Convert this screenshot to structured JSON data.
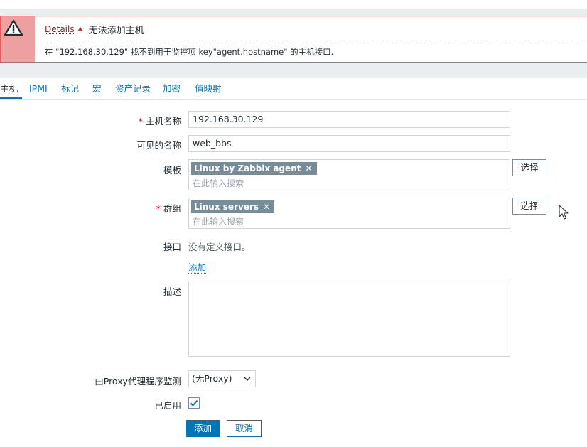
{
  "alert": {
    "details_label": "Details",
    "title": "无法添加主机",
    "message": "在 \"192.168.30.129\" 找不到用于监控项 key\"agent.hostname\" 的主机接口."
  },
  "tabs": [
    {
      "label": "主机",
      "active": true
    },
    {
      "label": "IPMI"
    },
    {
      "label": "标记"
    },
    {
      "label": "宏"
    },
    {
      "label": "资产记录"
    },
    {
      "label": "加密"
    },
    {
      "label": "值映射"
    }
  ],
  "form": {
    "host_name": {
      "label": "主机名称",
      "required_mark": "*",
      "value": "192.168.30.129"
    },
    "visible_name": {
      "label": "可见的名称",
      "value": "web_bbs"
    },
    "templates": {
      "label": "模板",
      "chip": "Linux by Zabbix agent",
      "placeholder": "在此输入搜索",
      "select_label": "选择"
    },
    "groups": {
      "label": "群组",
      "required_mark": "*",
      "chip": "Linux servers",
      "placeholder": "在此输入搜索",
      "select_label": "选择"
    },
    "interfaces": {
      "label": "接口",
      "empty_text": "没有定义接口。",
      "add_link": "添加"
    },
    "description": {
      "label": "描述",
      "value": ""
    },
    "proxy": {
      "label": "由Proxy代理程序监测",
      "selected": "(无Proxy)"
    },
    "enabled": {
      "label": "已启用",
      "checked": true
    }
  },
  "buttons": {
    "add": "添加",
    "cancel": "取消"
  },
  "colors": {
    "accent": "#0275b8",
    "alert_border": "#e45959",
    "alert_icon_bg": "#eda0a0",
    "chip_bg": "#768d99"
  }
}
